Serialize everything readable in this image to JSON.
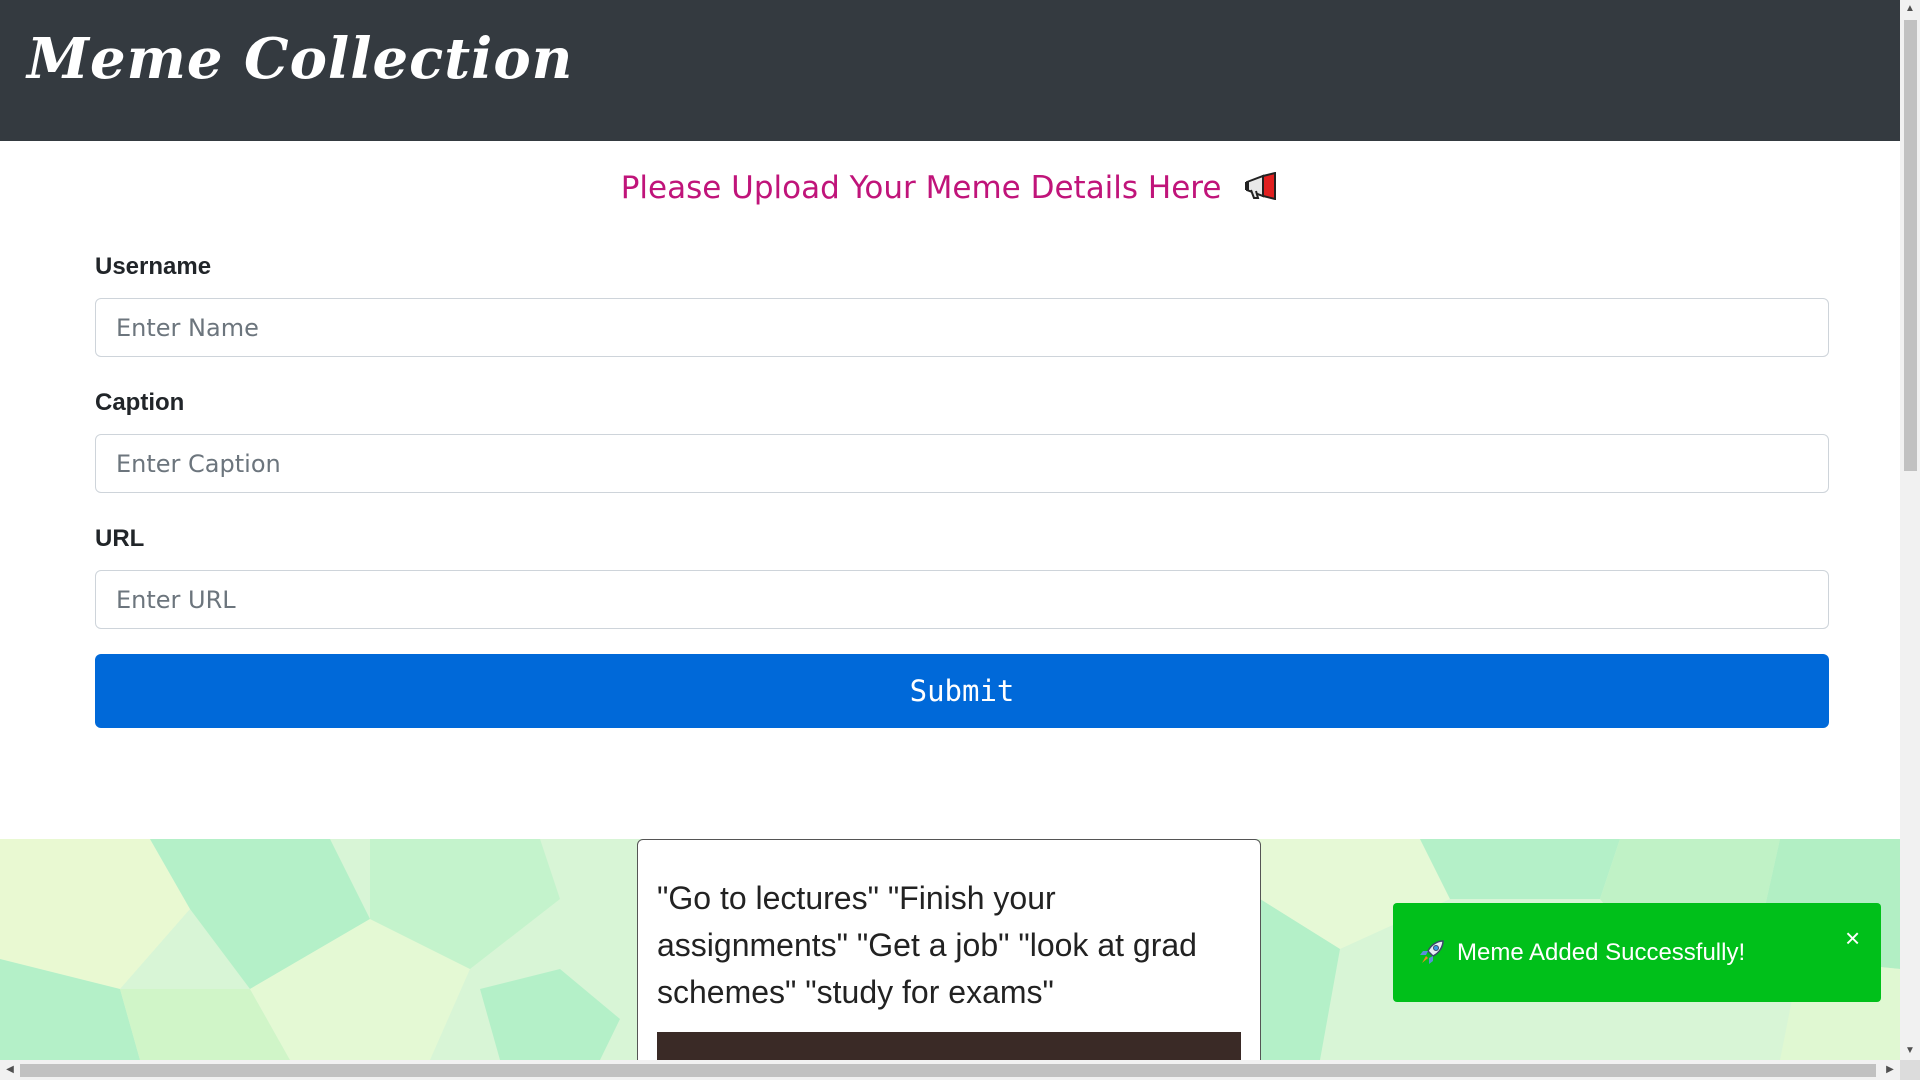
{
  "navbar": {
    "brand": "Meme Collection"
  },
  "form": {
    "heading": "Please Upload Your Meme Details Here",
    "heading_icon": "megaphone-icon",
    "username": {
      "label": "Username",
      "placeholder": "Enter Name",
      "value": ""
    },
    "caption": {
      "label": "Caption",
      "placeholder": "Enter Caption",
      "value": ""
    },
    "url": {
      "label": "URL",
      "placeholder": "Enter URL",
      "value": ""
    },
    "submit_label": "Submit"
  },
  "meme": {
    "caption_text": "\"Go to lectures\" \"Finish your assignments\" \"Get a job\" \"look at grad schemes\" \"study for exams\""
  },
  "toast": {
    "icon": "rocket-icon",
    "message": "Meme Added Successfully!",
    "close_label": "×",
    "color": "#00c01a"
  },
  "colors": {
    "navbar": "#343a40",
    "heading": "#c0147a",
    "primary": "#0069d9"
  }
}
